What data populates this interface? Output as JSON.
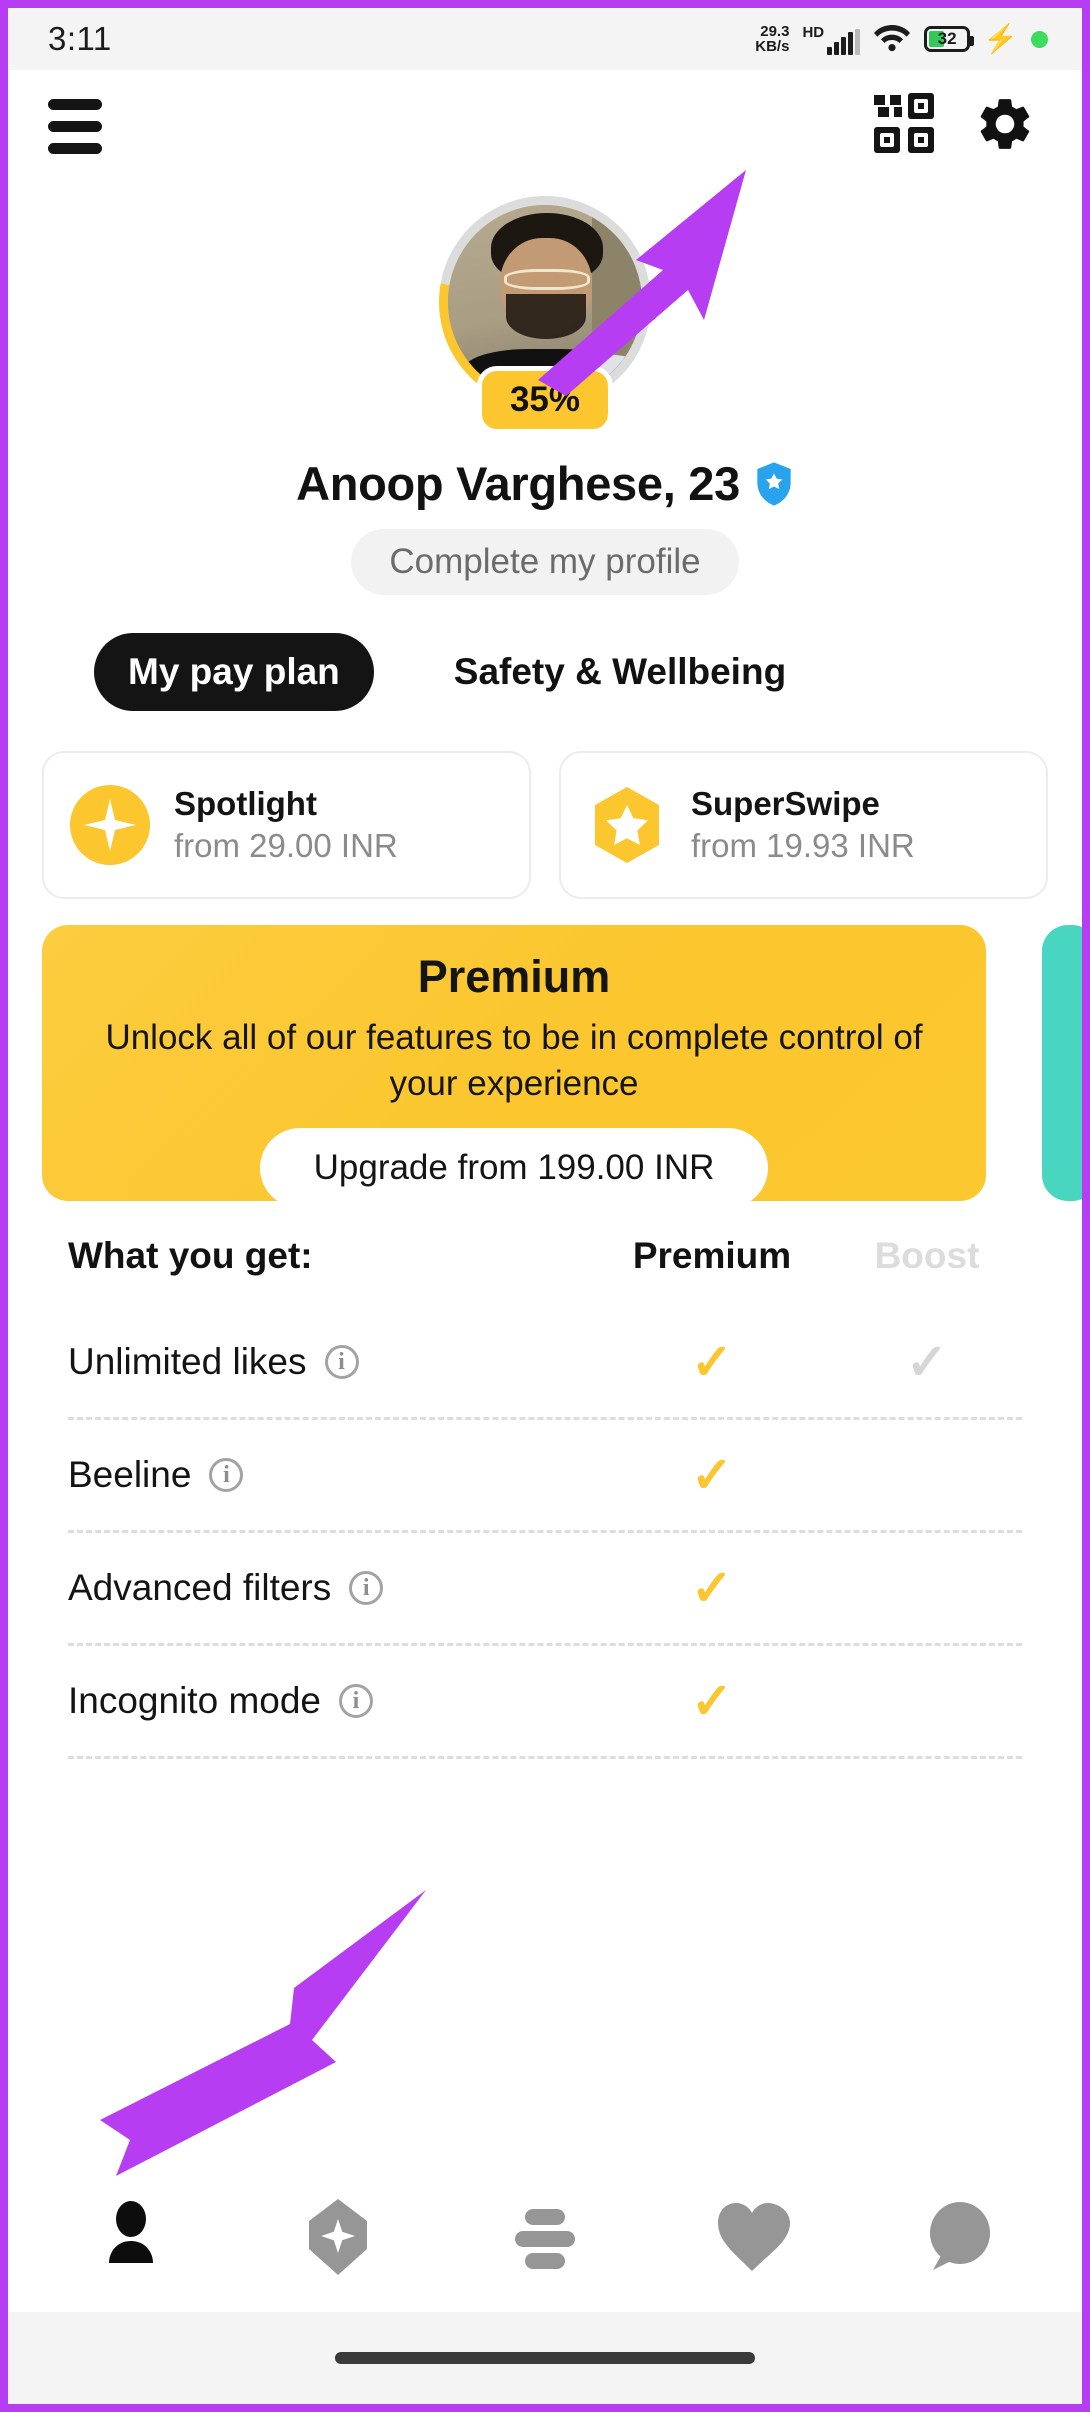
{
  "statusbar": {
    "time": "3:11",
    "net_speed_value": "29.3",
    "net_speed_unit": "KB/s",
    "network_type": "HD",
    "battery_percent": "32"
  },
  "appbar": {
    "menu_icon": "hamburger-menu-icon",
    "qr_icon": "qr-code-icon",
    "settings_icon": "gear-icon"
  },
  "profile": {
    "completion_percent": "35%",
    "name": "Anoop Varghese, 23",
    "verified_badge": "verified-shield-icon",
    "complete_profile_label": "Complete my profile"
  },
  "tabs": [
    {
      "label": "My pay plan",
      "active": true
    },
    {
      "label": "Safety & Wellbeing",
      "active": false
    }
  ],
  "feature_cards": [
    {
      "icon": "spotlight-sparkle-icon",
      "title": "Spotlight",
      "price": "from 29.00 INR"
    },
    {
      "icon": "superswipe-star-icon",
      "title": "SuperSwipe",
      "price": "from 19.93 INR"
    }
  ],
  "premium_card": {
    "title": "Premium",
    "description": "Unlock all of our features to be in complete control of your experience",
    "cta_label": "Upgrade from 199.00 INR",
    "accent_color": "#fbc62e",
    "next_card_color": "#48d6c0"
  },
  "comparison": {
    "headers": {
      "feature": "What you get:",
      "premium": "Premium",
      "boost": "Boost"
    },
    "rows": [
      {
        "label": "Unlimited likes",
        "info": "info-icon",
        "premium": "✓",
        "boost": "✓"
      },
      {
        "label": "Beeline",
        "info": "info-icon",
        "premium": "✓",
        "boost": ""
      },
      {
        "label": "Advanced filters",
        "info": "info-icon",
        "premium": "✓",
        "boost": ""
      },
      {
        "label": "Incognito mode",
        "info": "info-icon",
        "premium": "✓",
        "boost": ""
      }
    ]
  },
  "bottom_nav": [
    {
      "icon": "person-profile-icon",
      "active": true
    },
    {
      "icon": "spotlight-diamond-icon",
      "active": false
    },
    {
      "icon": "filters-sliders-icon",
      "active": false
    },
    {
      "icon": "heart-icon",
      "active": false
    },
    {
      "icon": "chat-bubble-icon",
      "active": false
    }
  ],
  "annotations": {
    "arrow_color": "#b63df2",
    "arrow_to_settings": "arrow-pointing-to-settings",
    "arrow_to_profile_tab": "arrow-pointing-to-profile-tab"
  }
}
